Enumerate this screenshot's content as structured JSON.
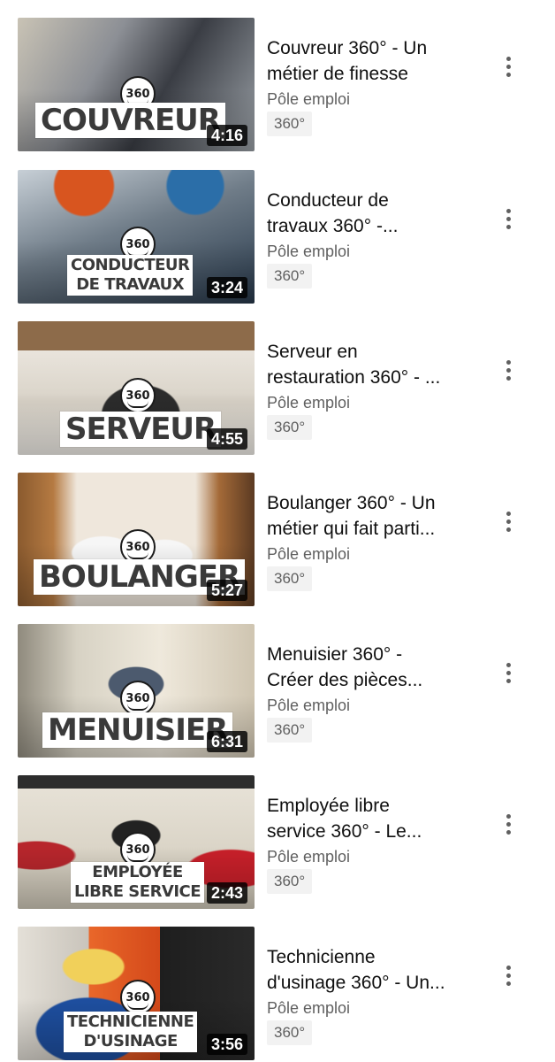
{
  "videos": [
    {
      "title_line1": "Couvreur 360° - Un",
      "title_line2": "métier de finesse",
      "channel": "Pôle emploi",
      "tag": "360°",
      "duration": "4:16",
      "thumb_label_lines": [
        "COUVREUR"
      ],
      "badge": "360",
      "colors": {
        "a": "#7b7f86",
        "b": "#c9c3b5",
        "c": "#3a3d44"
      }
    },
    {
      "title_line1": "Conducteur de",
      "title_line2": "travaux 360° -...",
      "channel": "Pôle emploi",
      "tag": "360°",
      "duration": "3:24",
      "thumb_label_lines": [
        "CONDUCTEUR",
        "DE TRAVAUX"
      ],
      "badge": "360",
      "colors": {
        "a": "#c7cfd6",
        "b": "#2b5f8f",
        "c": "#d8551f"
      }
    },
    {
      "title_line1": "Serveur en",
      "title_line2": "restauration 360° - ...",
      "channel": "Pôle emploi",
      "tag": "360°",
      "duration": "4:55",
      "thumb_label_lines": [
        "SERVEUR"
      ],
      "badge": "360",
      "colors": {
        "a": "#8d6b4a",
        "b": "#e9e4dc",
        "c": "#2c2c2c"
      }
    },
    {
      "title_line1": "Boulanger 360° - Un",
      "title_line2": "métier qui fait parti...",
      "channel": "Pôle emploi",
      "tag": "360°",
      "duration": "5:27",
      "thumb_label_lines": [
        "BOULANGER"
      ],
      "badge": "360",
      "colors": {
        "a": "#b57a42",
        "b": "#efe7dc",
        "c": "#5b3a22"
      }
    },
    {
      "title_line1": "Menuisier 360° -",
      "title_line2": "Créer des pièces...",
      "channel": "Pôle emploi",
      "tag": "360°",
      "duration": "6:31",
      "thumb_label_lines": [
        "MENUISIER"
      ],
      "badge": "360",
      "colors": {
        "a": "#d7d2c4",
        "b": "#9e9a8b",
        "c": "#4c5a6e"
      }
    },
    {
      "title_line1": "Employée libre",
      "title_line2": "service 360° - Le...",
      "channel": "Pôle emploi",
      "tag": "360°",
      "duration": "2:43",
      "thumb_label_lines": [
        "EMPLOYÉE",
        "LIBRE SERVICE"
      ],
      "badge": "360",
      "colors": {
        "a": "#b7262c",
        "b": "#e6e1d6",
        "c": "#2d2d2d"
      }
    },
    {
      "title_line1": "Technicienne",
      "title_line2": "d'usinage 360° - Un...",
      "channel": "Pôle emploi",
      "tag": "360°",
      "duration": "3:56",
      "thumb_label_lines": [
        "TECHNICIENNE",
        "D'USINAGE"
      ],
      "badge": "360",
      "colors": {
        "a": "#e9672a",
        "b": "#1e4fa0",
        "c": "#f1d05a"
      }
    }
  ]
}
